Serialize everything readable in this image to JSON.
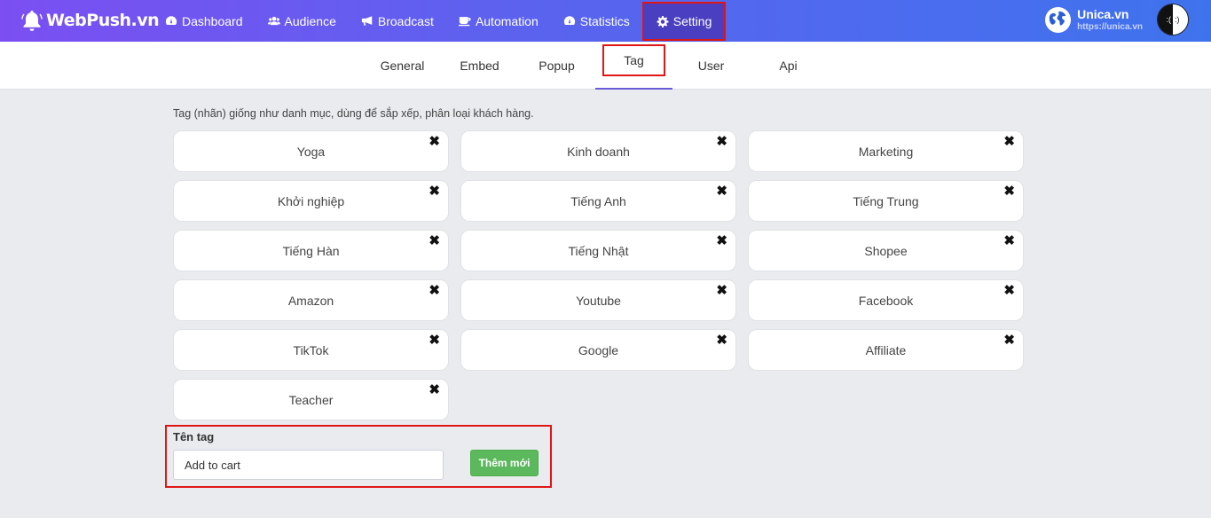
{
  "brand": {
    "name": "WebPush.vn"
  },
  "nav": {
    "items": [
      {
        "label": "Dashboard",
        "icon": "dashboard-icon"
      },
      {
        "label": "Audience",
        "icon": "users-icon"
      },
      {
        "label": "Broadcast",
        "icon": "bullhorn-icon"
      },
      {
        "label": "Automation",
        "icon": "coffee-icon"
      },
      {
        "label": "Statistics",
        "icon": "dashboard-icon"
      },
      {
        "label": "Setting",
        "icon": "gear-icon",
        "active": true
      }
    ]
  },
  "account": {
    "name": "Unica.vn",
    "url": "https://unica.vn"
  },
  "subtabs": [
    "General",
    "Embed",
    "Popup",
    "Tag",
    "User",
    "Api"
  ],
  "active_subtab": "Tag",
  "description": "Tag (nhãn) giống như danh mục, dùng để sắp xếp, phân loại khách hàng.",
  "tags": [
    "Yoga",
    "Kinh doanh",
    "Marketing",
    "Khởi nghiệp",
    "Tiếng Anh",
    "Tiếng Trung",
    "Tiếng Hàn",
    "Tiếng Nhật",
    "Shopee",
    "Amazon",
    "Youtube",
    "Facebook",
    "TikTok",
    "Google",
    "Affiliate",
    "Teacher"
  ],
  "delete_glyph": "✖",
  "form": {
    "label": "Tên tag",
    "input_value": "Add to cart",
    "button_label": "Thêm mới"
  },
  "colors": {
    "accent": "#6a5cd6",
    "highlight": "#e01616",
    "success": "#5cb85c"
  }
}
